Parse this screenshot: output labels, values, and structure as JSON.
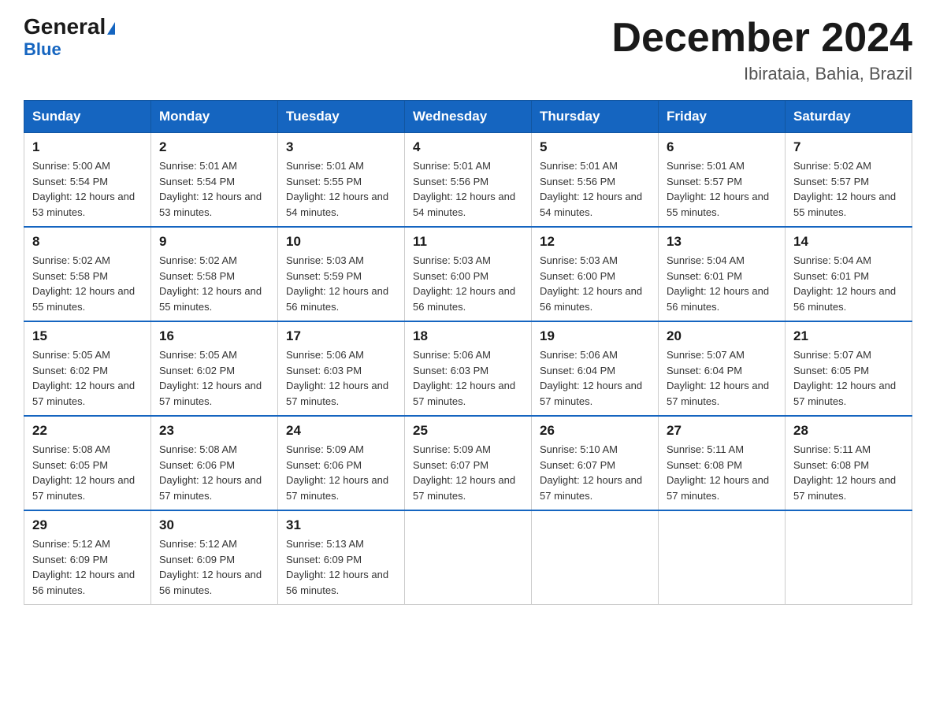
{
  "header": {
    "logo_general": "General",
    "logo_triangle": "▶",
    "logo_blue": "Blue",
    "title": "December 2024",
    "location": "Ibirataia, Bahia, Brazil"
  },
  "weekdays": [
    "Sunday",
    "Monday",
    "Tuesday",
    "Wednesday",
    "Thursday",
    "Friday",
    "Saturday"
  ],
  "weeks": [
    [
      {
        "day": "1",
        "sunrise": "5:00 AM",
        "sunset": "5:54 PM",
        "daylight": "12 hours and 53 minutes."
      },
      {
        "day": "2",
        "sunrise": "5:01 AM",
        "sunset": "5:54 PM",
        "daylight": "12 hours and 53 minutes."
      },
      {
        "day": "3",
        "sunrise": "5:01 AM",
        "sunset": "5:55 PM",
        "daylight": "12 hours and 54 minutes."
      },
      {
        "day": "4",
        "sunrise": "5:01 AM",
        "sunset": "5:56 PM",
        "daylight": "12 hours and 54 minutes."
      },
      {
        "day": "5",
        "sunrise": "5:01 AM",
        "sunset": "5:56 PM",
        "daylight": "12 hours and 54 minutes."
      },
      {
        "day": "6",
        "sunrise": "5:01 AM",
        "sunset": "5:57 PM",
        "daylight": "12 hours and 55 minutes."
      },
      {
        "day": "7",
        "sunrise": "5:02 AM",
        "sunset": "5:57 PM",
        "daylight": "12 hours and 55 minutes."
      }
    ],
    [
      {
        "day": "8",
        "sunrise": "5:02 AM",
        "sunset": "5:58 PM",
        "daylight": "12 hours and 55 minutes."
      },
      {
        "day": "9",
        "sunrise": "5:02 AM",
        "sunset": "5:58 PM",
        "daylight": "12 hours and 55 minutes."
      },
      {
        "day": "10",
        "sunrise": "5:03 AM",
        "sunset": "5:59 PM",
        "daylight": "12 hours and 56 minutes."
      },
      {
        "day": "11",
        "sunrise": "5:03 AM",
        "sunset": "6:00 PM",
        "daylight": "12 hours and 56 minutes."
      },
      {
        "day": "12",
        "sunrise": "5:03 AM",
        "sunset": "6:00 PM",
        "daylight": "12 hours and 56 minutes."
      },
      {
        "day": "13",
        "sunrise": "5:04 AM",
        "sunset": "6:01 PM",
        "daylight": "12 hours and 56 minutes."
      },
      {
        "day": "14",
        "sunrise": "5:04 AM",
        "sunset": "6:01 PM",
        "daylight": "12 hours and 56 minutes."
      }
    ],
    [
      {
        "day": "15",
        "sunrise": "5:05 AM",
        "sunset": "6:02 PM",
        "daylight": "12 hours and 57 minutes."
      },
      {
        "day": "16",
        "sunrise": "5:05 AM",
        "sunset": "6:02 PM",
        "daylight": "12 hours and 57 minutes."
      },
      {
        "day": "17",
        "sunrise": "5:06 AM",
        "sunset": "6:03 PM",
        "daylight": "12 hours and 57 minutes."
      },
      {
        "day": "18",
        "sunrise": "5:06 AM",
        "sunset": "6:03 PM",
        "daylight": "12 hours and 57 minutes."
      },
      {
        "day": "19",
        "sunrise": "5:06 AM",
        "sunset": "6:04 PM",
        "daylight": "12 hours and 57 minutes."
      },
      {
        "day": "20",
        "sunrise": "5:07 AM",
        "sunset": "6:04 PM",
        "daylight": "12 hours and 57 minutes."
      },
      {
        "day": "21",
        "sunrise": "5:07 AM",
        "sunset": "6:05 PM",
        "daylight": "12 hours and 57 minutes."
      }
    ],
    [
      {
        "day": "22",
        "sunrise": "5:08 AM",
        "sunset": "6:05 PM",
        "daylight": "12 hours and 57 minutes."
      },
      {
        "day": "23",
        "sunrise": "5:08 AM",
        "sunset": "6:06 PM",
        "daylight": "12 hours and 57 minutes."
      },
      {
        "day": "24",
        "sunrise": "5:09 AM",
        "sunset": "6:06 PM",
        "daylight": "12 hours and 57 minutes."
      },
      {
        "day": "25",
        "sunrise": "5:09 AM",
        "sunset": "6:07 PM",
        "daylight": "12 hours and 57 minutes."
      },
      {
        "day": "26",
        "sunrise": "5:10 AM",
        "sunset": "6:07 PM",
        "daylight": "12 hours and 57 minutes."
      },
      {
        "day": "27",
        "sunrise": "5:11 AM",
        "sunset": "6:08 PM",
        "daylight": "12 hours and 57 minutes."
      },
      {
        "day": "28",
        "sunrise": "5:11 AM",
        "sunset": "6:08 PM",
        "daylight": "12 hours and 57 minutes."
      }
    ],
    [
      {
        "day": "29",
        "sunrise": "5:12 AM",
        "sunset": "6:09 PM",
        "daylight": "12 hours and 56 minutes."
      },
      {
        "day": "30",
        "sunrise": "5:12 AM",
        "sunset": "6:09 PM",
        "daylight": "12 hours and 56 minutes."
      },
      {
        "day": "31",
        "sunrise": "5:13 AM",
        "sunset": "6:09 PM",
        "daylight": "12 hours and 56 minutes."
      },
      null,
      null,
      null,
      null
    ]
  ]
}
